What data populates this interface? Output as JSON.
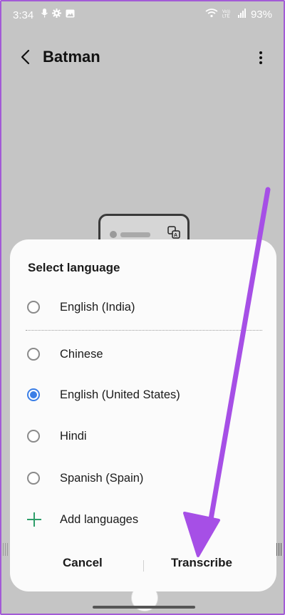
{
  "status_bar": {
    "time": "3:34",
    "left_icons": [
      "microphone-icon",
      "gear-icon",
      "image-icon"
    ],
    "right_icons": [
      "wifi-icon",
      "volte-icon",
      "signal-icon"
    ],
    "battery": "93%"
  },
  "app_bar": {
    "title": "Batman",
    "back_icon": "chevron-left-icon",
    "more_icon": "more-vertical-icon"
  },
  "dialog": {
    "title": "Select language",
    "options": [
      {
        "label": "English (India)",
        "selected": false
      },
      {
        "label": "Chinese",
        "selected": false
      },
      {
        "label": "English (United States)",
        "selected": true
      },
      {
        "label": "Hindi",
        "selected": false
      },
      {
        "label": "Spanish (Spain)",
        "selected": false
      }
    ],
    "add_label": "Add languages",
    "cancel_label": "Cancel",
    "transcribe_label": "Transcribe"
  },
  "colors": {
    "accent_radio": "#3a7ee6",
    "add_plus": "#2e9e6a",
    "annotation_arrow": "#a64fe6",
    "overlay": "#c5c5c5"
  }
}
